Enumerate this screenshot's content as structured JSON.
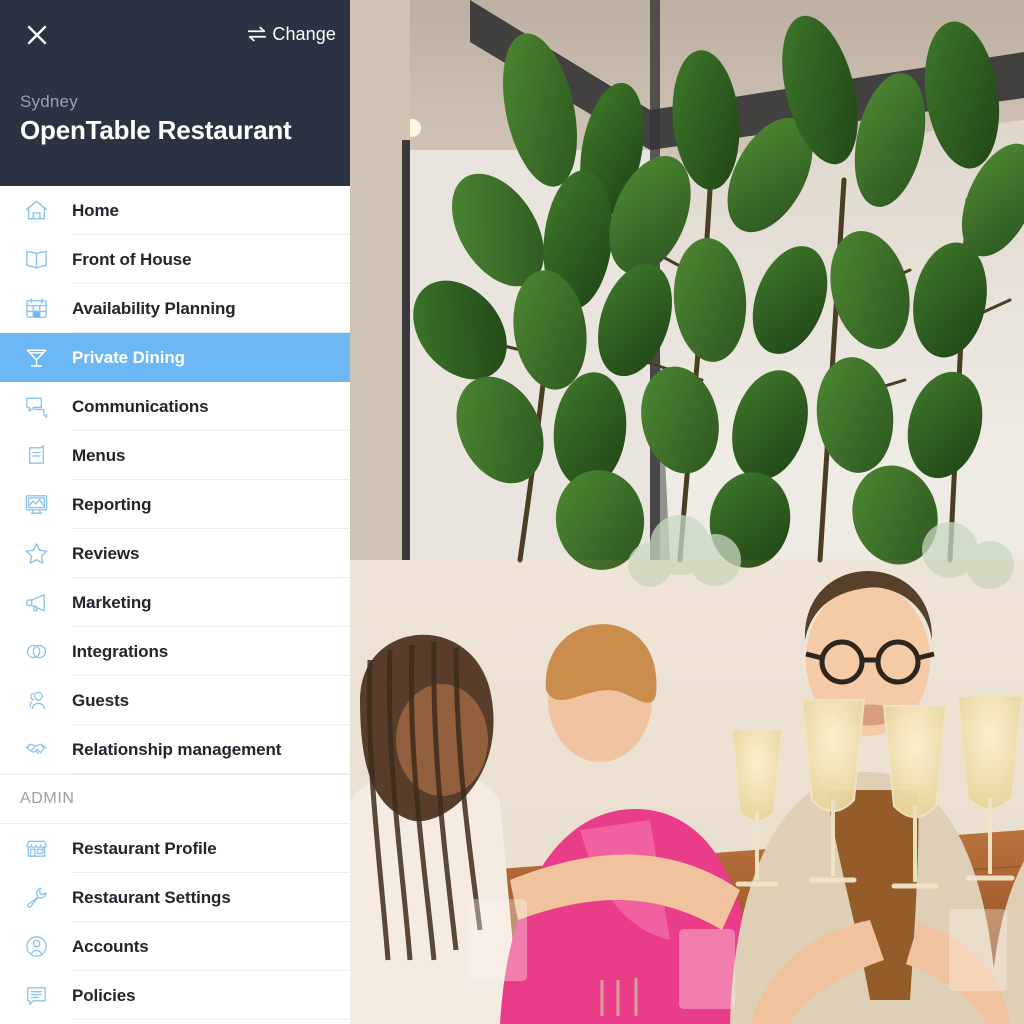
{
  "header": {
    "close_icon": "close-icon",
    "change_label": "Change",
    "change_icon": "swap-arrows-icon",
    "city": "Sydney",
    "restaurant_name": "OpenTable Restaurant",
    "background_color": "#2b3342"
  },
  "theme": {
    "accent": "#6db7f5",
    "icon_blue": "#8fc4ef",
    "text_dark": "#21262e",
    "divider": "#ededee",
    "muted": "#9b9ea3"
  },
  "nav": {
    "items": [
      {
        "label": "Home",
        "icon": "home-icon",
        "active": false
      },
      {
        "label": "Front of House",
        "icon": "open-book-icon",
        "active": false
      },
      {
        "label": "Availability Planning",
        "icon": "calendar-icon",
        "active": false
      },
      {
        "label": "Private Dining",
        "icon": "martini-glass-icon",
        "active": true
      },
      {
        "label": "Communications",
        "icon": "chat-bubbles-icon",
        "active": false
      },
      {
        "label": "Menus",
        "icon": "menu-card-icon",
        "active": false
      },
      {
        "label": "Reporting",
        "icon": "monitor-chart-icon",
        "active": false
      },
      {
        "label": "Reviews",
        "icon": "star-icon",
        "active": false
      },
      {
        "label": "Marketing",
        "icon": "megaphone-icon",
        "active": false
      },
      {
        "label": "Integrations",
        "icon": "two-circles-icon",
        "active": false
      },
      {
        "label": "Guests",
        "icon": "people-icon",
        "active": false
      },
      {
        "label": "Relationship management",
        "icon": "handshake-icon",
        "active": false
      }
    ],
    "admin_section_label": "ADMIN",
    "admin_items": [
      {
        "label": "Restaurant Profile",
        "icon": "storefront-icon"
      },
      {
        "label": "Restaurant Settings",
        "icon": "wrench-icon"
      },
      {
        "label": "Accounts",
        "icon": "user-circle-icon"
      },
      {
        "label": "Policies",
        "icon": "document-lines-icon"
      }
    ]
  },
  "photo": {
    "description": "Group of friends toasting white wine at a restaurant table under a large fiddle-leaf fig plant"
  }
}
